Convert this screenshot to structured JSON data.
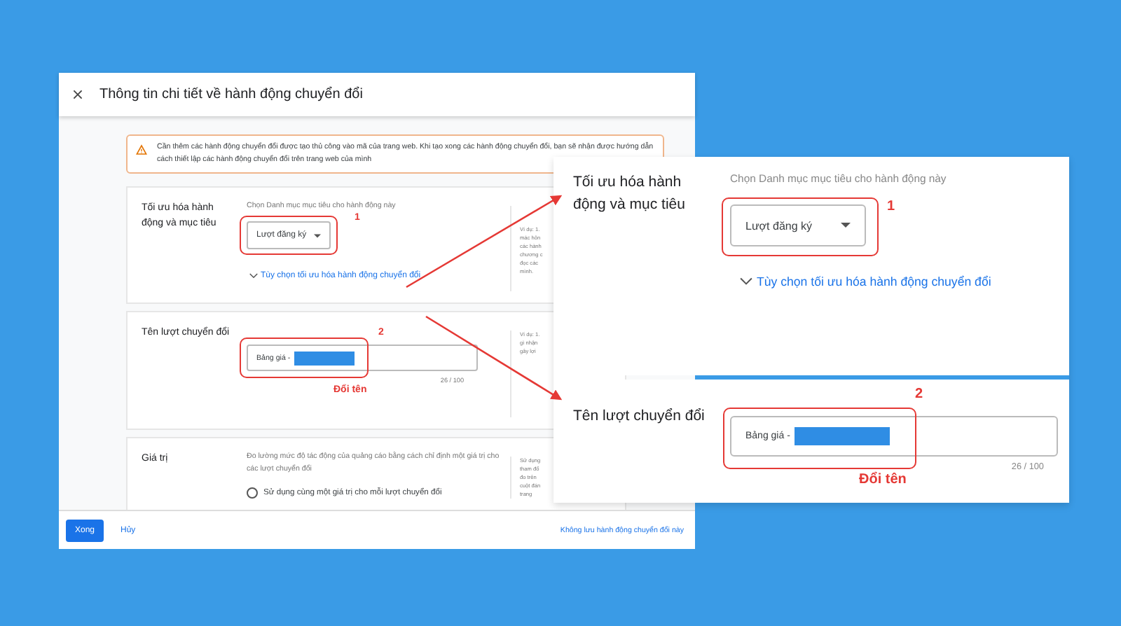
{
  "dialog": {
    "title": "Thông tin chi tiết về hành động chuyển đổi",
    "warning": "Cần thêm các hành động chuyển đổi được tạo thủ công vào mã của trang web. Khi tạo xong các hành động chuyển đổi, bạn sẽ nhận được hướng dẫn cách thiết lập các hành động chuyển đổi trên trang web của mình",
    "sections": [
      {
        "kind": "select",
        "label": "Tối ưu hóa hành động và mục tiêu",
        "hint": "Chọn Danh mục mục tiêu cho hành động này",
        "value": "Lượt đăng ký",
        "link": "Tùy chọn tối ưu hóa hành động chuyển đổi",
        "marker": "1",
        "help": [
          "Ví dụ: 1.",
          "mác hôn",
          "các hành",
          "chương c",
          "đọc các",
          "mình."
        ]
      },
      {
        "kind": "text",
        "label": "Tên lượt chuyển đổi",
        "value": "Bảng giá -",
        "counter": "26 / 100",
        "marker": "2",
        "note": "Đổi tên",
        "help": [
          "Ví dụ: 1.",
          "gì nhận",
          "gây lợi"
        ]
      },
      {
        "kind": "radio",
        "label": "Giá trị",
        "hint": "Đo lường mức độ tác động của quảng cáo bằng cách chỉ định một giá trị cho các lượt chuyển đổi",
        "options": [
          {
            "label": "Sử dụng cùng một giá trị cho mỗi lượt chuyển đổi",
            "selected": false
          }
        ],
        "help": [
          "Sử dụng",
          "tham đổ",
          "đo trên",
          "cuột đán",
          "trang"
        ]
      }
    ],
    "footer": {
      "done": "Xong",
      "cancel": "Hủy",
      "discard": "Không lưu hành động chuyển đổi này"
    }
  },
  "zoom": {
    "sections": [
      {
        "kind": "select",
        "label": "Tối ưu hóa hành động và mục tiêu",
        "hint": "Chọn Danh mục mục tiêu cho hành động này",
        "value": "Lượt đăng ký",
        "link": "Tùy chọn tối ưu hóa hành động chuyển đổi",
        "marker": "1"
      },
      {
        "kind": "text",
        "label": "Tên lượt chuyển đổi",
        "value": "Bảng giá -",
        "counter": "26 / 100",
        "marker": "2",
        "note": "Đổi tên"
      }
    ]
  }
}
